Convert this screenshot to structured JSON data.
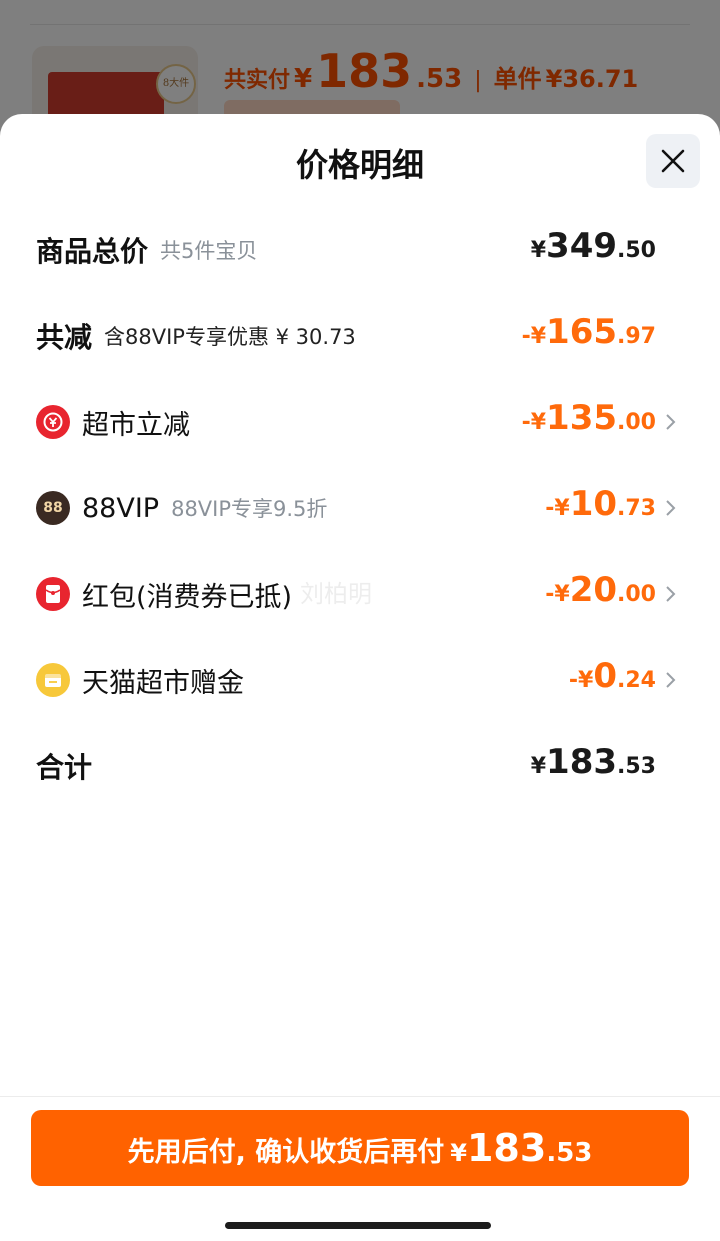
{
  "background": {
    "top_text": "",
    "price_label": "共实付",
    "price_currency": "¥",
    "price_int": "183",
    "price_dec": ".53",
    "unit_label": "单件",
    "unit_price": "¥36.71",
    "thumb_badge": "8大件"
  },
  "sheet": {
    "title": "价格明细",
    "rows": {
      "total": {
        "label": "商品总价",
        "sub": "共5件宝贝",
        "currency": "¥",
        "int": "349",
        "dec": ".50"
      },
      "reduce": {
        "label": "共减",
        "sub": "含88VIP专享优惠 ¥ 30.73",
        "currency": "-¥",
        "int": "165",
        "dec": ".97"
      },
      "market": {
        "label": "超市立减",
        "currency": "-¥",
        "int": "135",
        "dec": ".00"
      },
      "vip": {
        "label": "88VIP",
        "sub": "88VIP专享9.5折",
        "currency": "-¥",
        "int": "10",
        "dec": ".73",
        "icon_text": "88"
      },
      "hongbao": {
        "label": "红包(消费券已抵)",
        "currency": "-¥",
        "int": "20",
        "dec": ".00"
      },
      "gift": {
        "label": "天猫超市赠金",
        "currency": "-¥",
        "int": "0",
        "dec": ".24"
      },
      "sum": {
        "label": "合计",
        "currency": "¥",
        "int": "183",
        "dec": ".53"
      }
    },
    "watermark": "刘柏明"
  },
  "footer": {
    "pay_text": "先用后付, 确认收货后再付",
    "currency": "¥",
    "int": "183",
    "dec": ".53"
  },
  "colors": {
    "accent": "#ff6200",
    "discount": "#ff6a0b",
    "market_icon": "#e8252f",
    "vip_icon": "#3a2a22",
    "hongbao_icon": "#e8252f",
    "gift_icon": "#f7c83a"
  }
}
